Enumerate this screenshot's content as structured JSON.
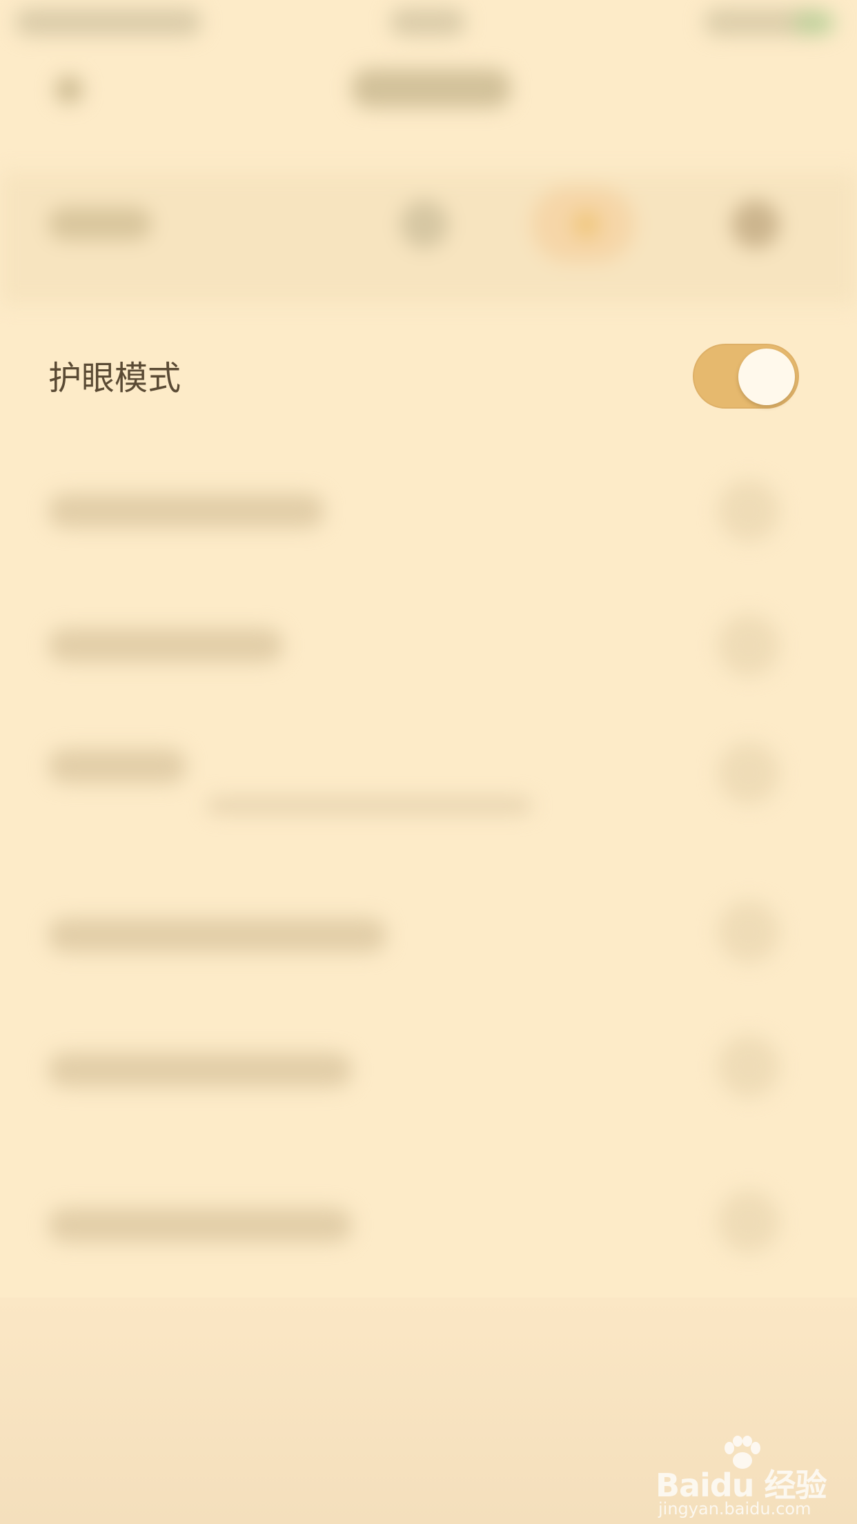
{
  "setting": {
    "label": "护眼模式",
    "enabled": true
  },
  "colors": {
    "background": "#fdebc8",
    "toggle_on": "#e6b96e",
    "label_text": "#5a4a34"
  },
  "watermark": {
    "brand": "Baidu 经验",
    "url": "jingyan.baidu.com"
  }
}
